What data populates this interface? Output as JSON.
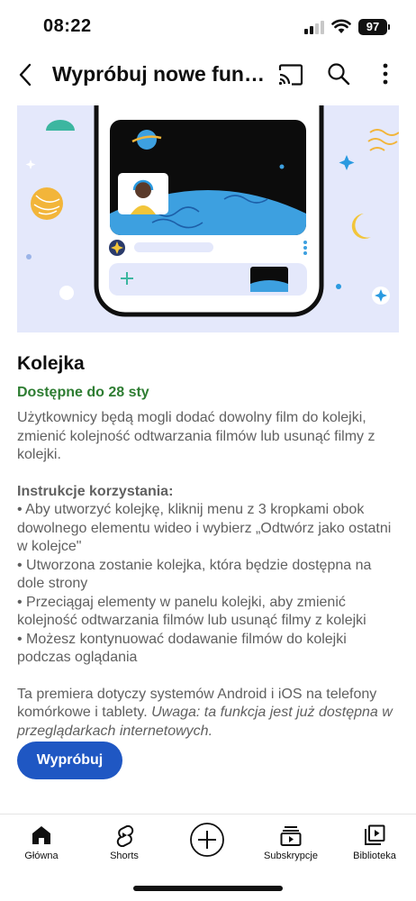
{
  "status_bar": {
    "time": "08:22",
    "battery": "97"
  },
  "app_bar": {
    "title": "Wypróbuj nowe fun…",
    "icons": [
      "back-arrow-icon",
      "cast-icon",
      "search-icon",
      "more-vert-icon"
    ]
  },
  "feature": {
    "title": "Kolejka",
    "availability": "Dostępne do 28 sty",
    "description": "Użytkownicy będą mogli dodać dowolny film do kolejki, zmienić kolejność odtwarzania filmów lub usunąć filmy z kolejki.",
    "instructions_title": "Instrukcje korzystania:",
    "instructions": [
      "• Aby utworzyć kolejkę, kliknij menu z 3 kropkami obok dowolnego elementu wideo i wybierz „Odtwórz jako ostatni w kolejce\"",
      "• Utworzona zostanie kolejka, która będzie dostępna na dole strony",
      "• Przeciągaj elementy w panelu kolejki, aby zmienić kolejność odtwarzania filmów lub usunąć filmy z kolejki",
      "• Możesz kontynuować dodawanie filmów do kolejki podczas oglądania"
    ],
    "platform_note": "Ta premiera dotyczy systemów Android i iOS na telefony komórkowe i tablety.",
    "platform_note_italic": "Uwaga: ta funkcja jest już dostępna w przeglądarkach internetowych."
  },
  "try_button": "Wypróbuj",
  "bottom_nav": {
    "items": [
      {
        "label": "Główna",
        "icon": "home-icon"
      },
      {
        "label": "Shorts",
        "icon": "shorts-icon"
      },
      {
        "label": "",
        "icon": "add-circle-icon"
      },
      {
        "label": "Subskrypcje",
        "icon": "subscriptions-icon"
      },
      {
        "label": "Biblioteka",
        "icon": "library-icon"
      }
    ]
  },
  "colors": {
    "accent_blue": "#1f57c3",
    "availability_green": "#2e7d32",
    "illustration_bg": "#e4e8fb"
  }
}
